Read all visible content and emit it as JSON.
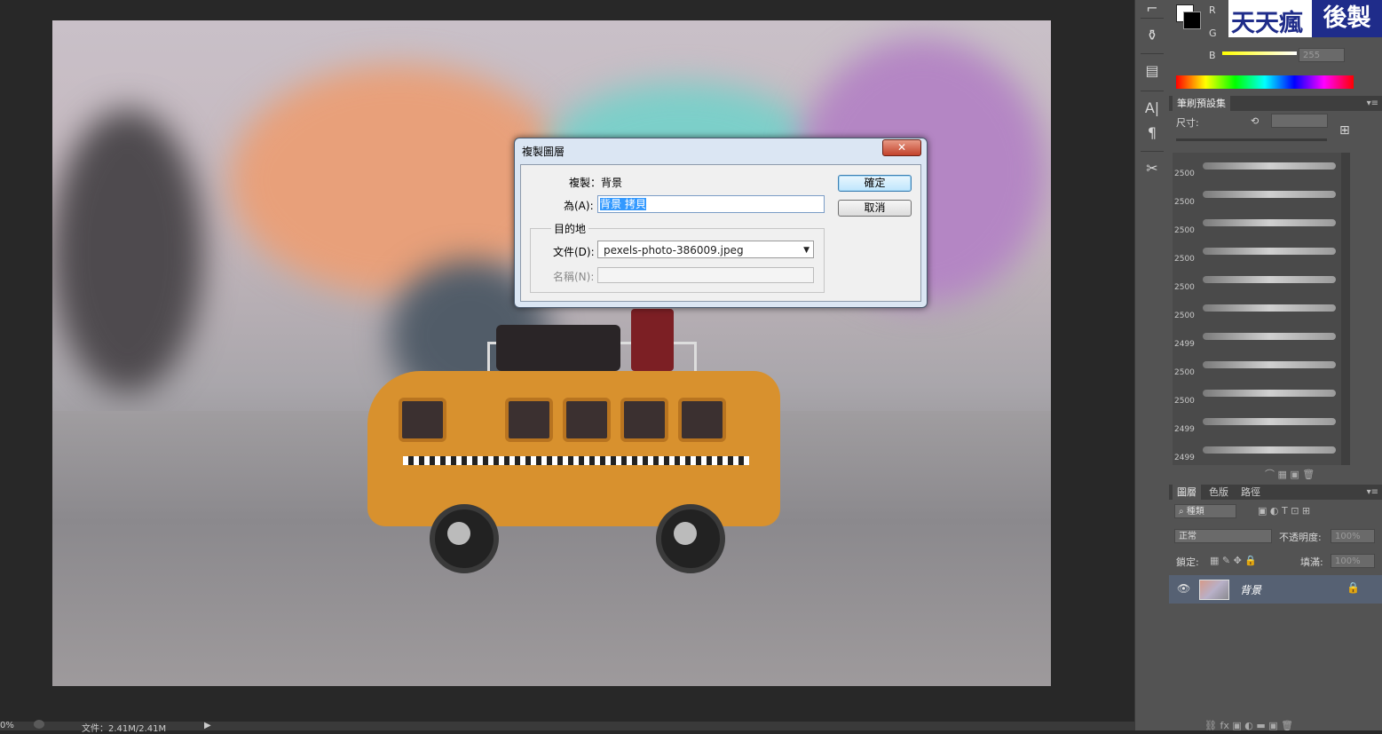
{
  "dialog": {
    "title": "複製圖層",
    "close_label": "✕",
    "duplicate_label": "複製：",
    "duplicate_value": "背景",
    "as_label": "為(A):",
    "as_value": "背景 拷貝",
    "destination_label": "目的地",
    "document_label": "文件(D):",
    "document_value": "pexels-photo-386009.jpeg",
    "name_label": "名稱(N):",
    "ok_label": "確定",
    "cancel_label": "取消"
  },
  "color_panel": {
    "r_label": "R",
    "g_label": "G",
    "b_label": "B",
    "b_value": "255"
  },
  "brush_presets": {
    "tab_label": "筆刷預設集",
    "size_label": "尺寸:",
    "sizes": [
      "2500",
      "2500",
      "2500",
      "2500",
      "2500",
      "2500",
      "2499",
      "2500",
      "2500",
      "2499",
      "2499"
    ]
  },
  "layers_panel": {
    "tabs": [
      "圖層",
      "色版",
      "路徑"
    ],
    "filter_label": "種類",
    "blend_mode": "正常",
    "opacity_label": "不透明度:",
    "opacity_value": "100%",
    "lock_label": "鎖定:",
    "fill_label": "填滿:",
    "fill_value": "100%",
    "layer_name": "背景"
  },
  "watermark": {
    "left": "天天瘋",
    "right": "後製"
  },
  "status": {
    "zoom": "0%",
    "file_info": "文件：2.41M/2.41M"
  }
}
